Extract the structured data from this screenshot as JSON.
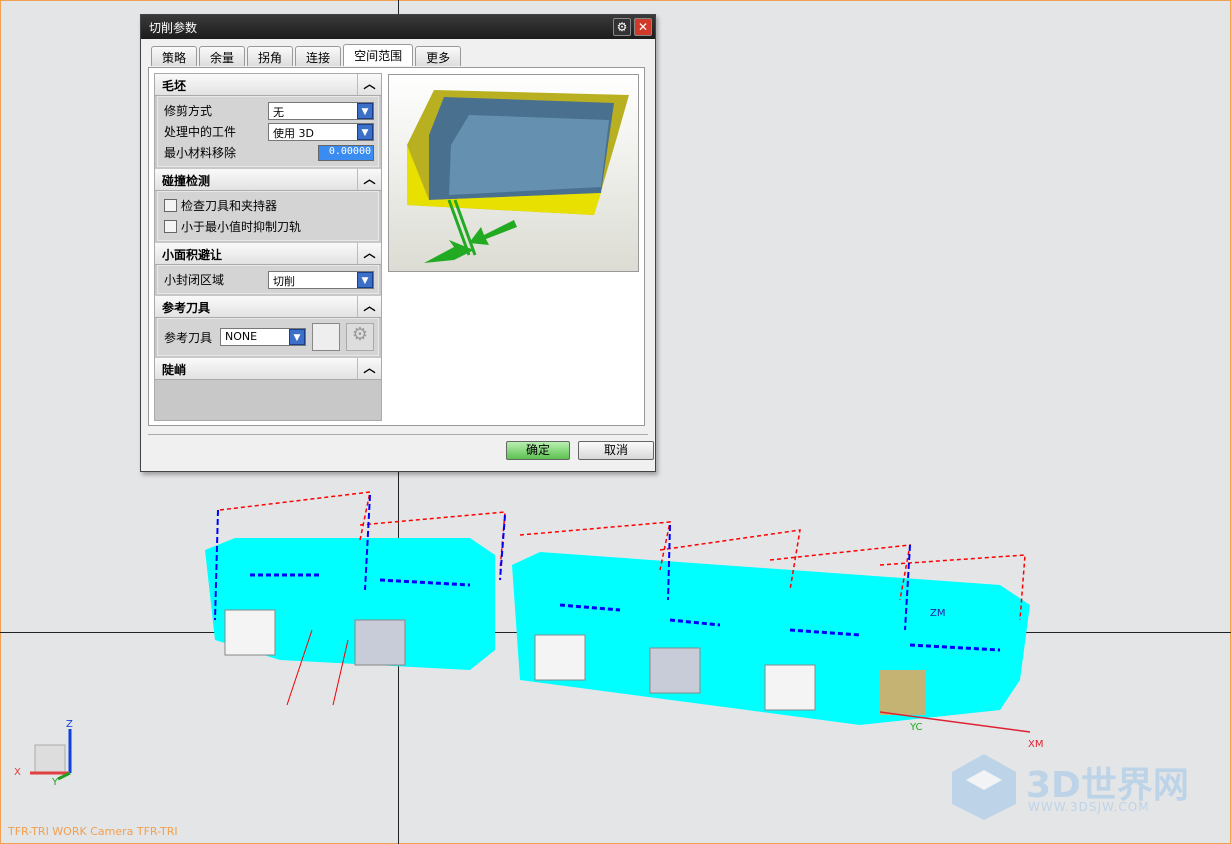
{
  "dialog": {
    "title": "切削参数",
    "tabs": [
      "策略",
      "余量",
      "拐角",
      "连接",
      "空间范围",
      "更多"
    ],
    "active_tab": "空间范围",
    "sections": {
      "blank": {
        "title": "毛坯",
        "trim_label": "修剪方式",
        "trim_value": "无",
        "ipw_label": "处理中的工件",
        "ipw_value": "使用 3D",
        "min_removal_label": "最小材料移除",
        "min_removal_value": "0.00000"
      },
      "collision": {
        "title": "碰撞检测",
        "check_holder": "检查刀具和夹持器",
        "suppress_min": "小于最小值时抑制刀轨"
      },
      "small_area": {
        "title": "小面积避让",
        "closed_label": "小封闭区域",
        "closed_value": "切削"
      },
      "ref_tool": {
        "title": "参考刀具",
        "label": "参考刀具",
        "value": "NONE"
      },
      "steep": {
        "title": "陡峭"
      }
    },
    "ok": "确定",
    "cancel": "取消"
  },
  "viewport": {
    "status": "TFR-TRI WORK Camera TFR-TRI",
    "axes": {
      "x": "X",
      "y": "Y",
      "z": "Z",
      "xm": "XM",
      "yc": "YC",
      "zm": "ZM"
    }
  },
  "watermark": {
    "name": "3D世界网",
    "url": "WWW.3DSJW.COM"
  }
}
